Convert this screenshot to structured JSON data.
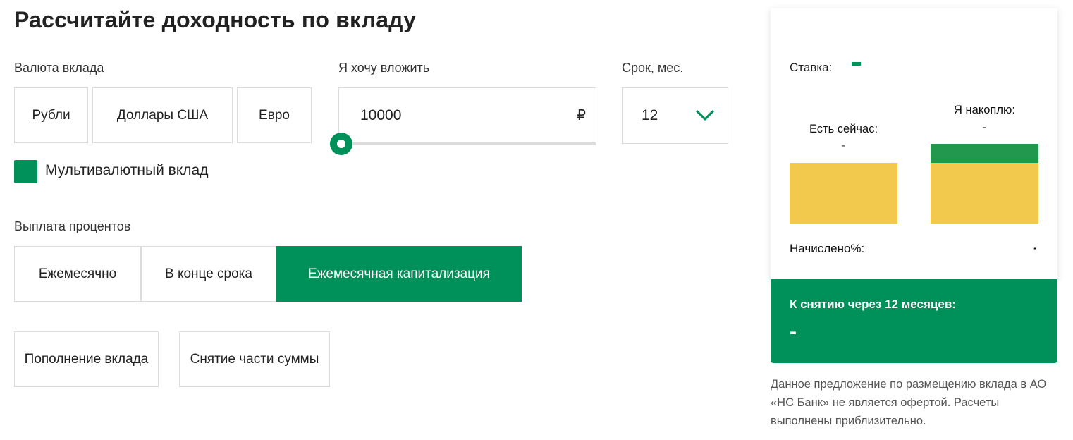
{
  "page": {
    "title": "Рассчитайте доходность по вкладу"
  },
  "currency": {
    "label": "Валюта вклада",
    "options": [
      "Рубли",
      "Доллары США",
      "Евро"
    ]
  },
  "amount": {
    "label": "Я хочу вложить",
    "value": "10000",
    "currency_sign": "₽",
    "slider_level": 0
  },
  "term": {
    "label": "Срок, мес.",
    "value": "12"
  },
  "multicurrency": {
    "label": "Мультивалютный вклад",
    "checked": true
  },
  "payout": {
    "label": "Выплата процентов",
    "options": [
      "Ежемесячно",
      "В конце срока",
      "Ежемесячная капитализация"
    ],
    "selected": "Ежемесячная капитализация"
  },
  "extras": {
    "options": [
      "Пополнение вклада",
      "Снятие части суммы"
    ]
  },
  "summary": {
    "rate_label": "Ставка:",
    "now_label": "Есть сейчас:",
    "now_value": "-",
    "will_have_label": "Я накоплю:",
    "will_have_value": "-",
    "accrued_label": "Начислено%:",
    "accrued_value": "-",
    "withdraw_label": "К снятию через 12 месяцев:",
    "withdraw_value": "-"
  },
  "disclaimer": "Данное предложение по размещению вклада в АО «НС Банк» не является офертой. Расчеты выполнены приблизительно.",
  "colors": {
    "accent": "#00905a",
    "bar_base": "#f2c94c",
    "bar_interest": "#22984f"
  },
  "icons": {
    "term_dropdown": "chevron-down-icon"
  }
}
